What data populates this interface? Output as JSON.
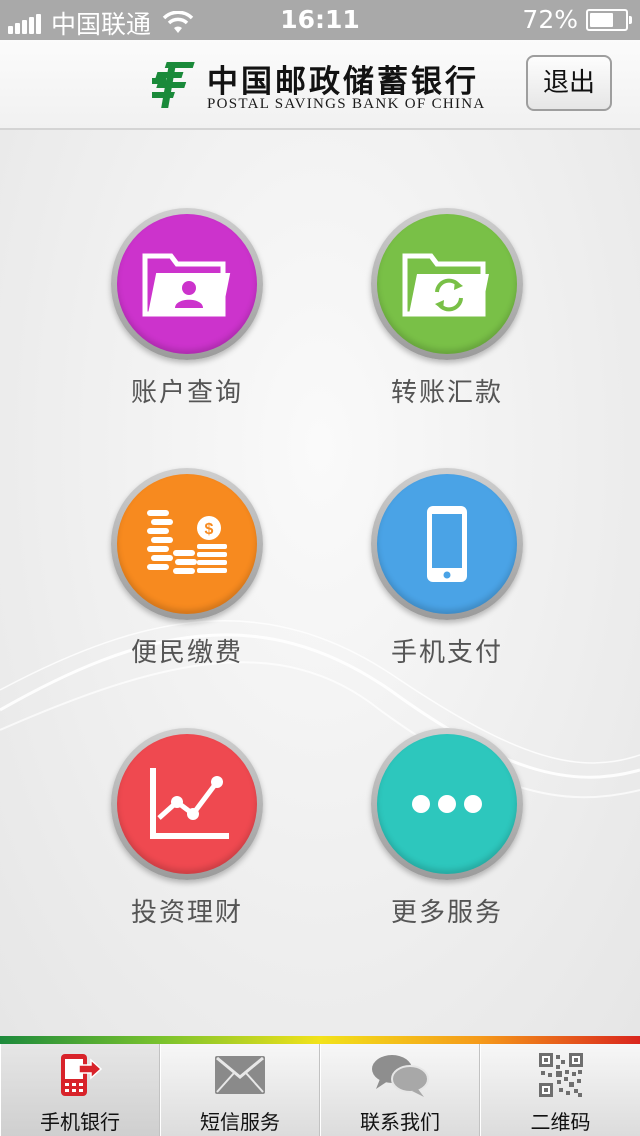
{
  "status_bar": {
    "carrier": "中国联通",
    "time": "16:11",
    "battery_text": "72%",
    "battery_level": 0.72,
    "signal_bars": 5
  },
  "header": {
    "logo_cn": "中国邮政储蓄银行",
    "logo_en": "POSTAL SAVINGS BANK OF CHINA",
    "logout_label": "退出"
  },
  "menu": [
    {
      "label": "账户查询",
      "icon": "folder-user-icon",
      "color": "#cc33cc"
    },
    {
      "label": "转账汇款",
      "icon": "folder-transfer-icon",
      "color": "#79c047"
    },
    {
      "label": "便民缴费",
      "icon": "coins-icon",
      "color": "#f78a1f"
    },
    {
      "label": "手机支付",
      "icon": "phone-icon",
      "color": "#4aa3e6"
    },
    {
      "label": "投资理财",
      "icon": "line-chart-icon",
      "color": "#ef4950"
    },
    {
      "label": "更多服务",
      "icon": "more-dots-icon",
      "color": "#2dc7bd"
    }
  ],
  "tabs": [
    {
      "label": "手机银行",
      "icon": "mobile-bank-icon",
      "active": true
    },
    {
      "label": "短信服务",
      "icon": "envelope-icon",
      "active": false
    },
    {
      "label": "联系我们",
      "icon": "chat-bubbles-icon",
      "active": false
    },
    {
      "label": "二维码",
      "icon": "qr-code-icon",
      "active": false
    }
  ],
  "colors": {
    "status_bar": "#a9a9a9",
    "logo_green": "#1a8a3a",
    "label_text": "#555555"
  }
}
